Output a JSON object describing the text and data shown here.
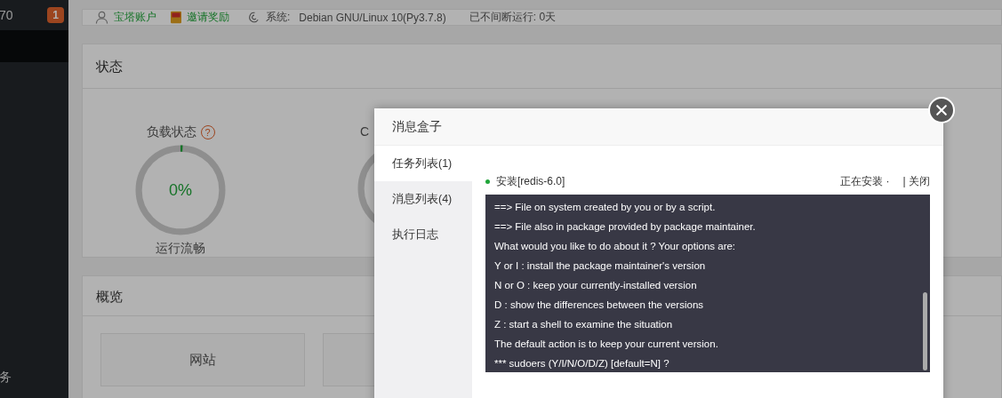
{
  "sidebar": {
    "top_item": "70",
    "badge": "1",
    "bottom_item": "务"
  },
  "top_bar": {
    "account": "宝塔账户",
    "invite": "邀请奖励",
    "system_label": "系统:",
    "system_value": "Debian GNU/Linux 10(Py3.7.8)",
    "uptime": "已不间断运行: 0天"
  },
  "status_panel": {
    "title": "状态",
    "gauges": [
      {
        "title": "负载状态",
        "help_mark": "?",
        "value": "0%",
        "status": "运行流畅",
        "level": 0
      },
      {
        "title": "C"
      }
    ]
  },
  "overview_panel": {
    "title": "概览",
    "cards": [
      "网站"
    ]
  },
  "modal": {
    "title": "消息盒子",
    "tabs": [
      {
        "label": "任务列表(1)",
        "selected": true
      },
      {
        "label": "消息列表(4)",
        "selected": false
      },
      {
        "label": "执行日志",
        "selected": false
      }
    ],
    "task": {
      "name": "安装[redis-6.0]",
      "status": "正在安装 ·",
      "close_link": "| 关闭"
    },
    "log_lines": [
      "==> File on system created by you or by a script.",
      "==> File also in package provided by package maintainer.",
      "What would you like to do about it ? Your options are:",
      "Y or I : install the package maintainer's version",
      "N or O : keep your currently-installed version",
      "D : show the differences between the versions",
      "Z : start a shell to examine the situation",
      "The default action is to keep your current version.",
      "*** sudoers (Y/I/N/O/D/Z) [default=N] ?"
    ]
  }
}
